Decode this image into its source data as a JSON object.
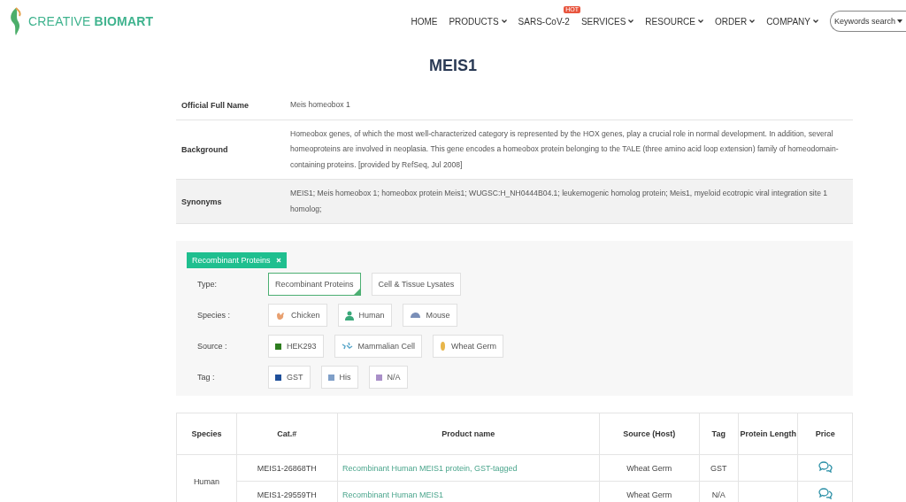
{
  "header": {
    "logo": {
      "word_1": "CREATIVE",
      "word_2": "BIOMART"
    },
    "nav": [
      {
        "label": "HOME",
        "dropdown": false
      },
      {
        "label": "PRODUCTS",
        "dropdown": true
      },
      {
        "label": "SARS-CoV-2",
        "dropdown": false,
        "badge": "HOT"
      },
      {
        "label": "SERVICES",
        "dropdown": true
      },
      {
        "label": "RESOURCE",
        "dropdown": true
      },
      {
        "label": "ORDER",
        "dropdown": true
      },
      {
        "label": "COMPANY",
        "dropdown": true
      }
    ],
    "search": {
      "placeholder": "Keywords search"
    }
  },
  "title": "MEIS1",
  "info": [
    {
      "label": "Official Full Name",
      "value": "Meis homeobox 1",
      "shaded": false
    },
    {
      "label": "Background",
      "value": "Homeobox genes, of which the most well-characterized category is represented by the HOX genes, play a crucial role in normal development. In addition, several homeoproteins are involved in neoplasia. This gene encodes a homeobox protein belonging to the TALE (three amino acid loop extension) family of homeodomain-containing proteins. [provided by RefSeq, Jul 2008]",
      "shaded": false
    },
    {
      "label": "Synonyms",
      "value": "MEIS1; Meis homeobox 1; homeobox protein Meis1; WUGSC:H_NH0444B04.1; leukemogenic homolog protein; Meis1, myeloid ecotropic viral integration site 1 homolog;",
      "shaded": true
    }
  ],
  "filters": {
    "active_tag": "Recombinant Proteins",
    "groups": [
      {
        "label": "Type:",
        "options": [
          {
            "label": "Recombinant Proteins",
            "kind": "plain",
            "selected": true
          },
          {
            "label": "Cell & Tissue Lysates",
            "kind": "plain",
            "selected": false
          }
        ]
      },
      {
        "label": "Species :",
        "options": [
          {
            "label": "Chicken",
            "kind": "chicken",
            "selected": false
          },
          {
            "label": "Human",
            "kind": "person",
            "selected": false
          },
          {
            "label": "Mouse",
            "kind": "mouse",
            "selected": false
          }
        ]
      },
      {
        "label": "Source :",
        "options": [
          {
            "label": "HEK293",
            "kind": "square",
            "color": "#2e7d1f",
            "selected": false
          },
          {
            "label": "Mammalian Cell",
            "kind": "cell",
            "selected": false
          },
          {
            "label": "Wheat Germ",
            "kind": "wheat",
            "selected": false
          }
        ]
      },
      {
        "label": "Tag :",
        "options": [
          {
            "label": "GST",
            "kind": "square",
            "color": "#1f4f9a",
            "selected": false
          },
          {
            "label": "His",
            "kind": "square",
            "color": "#7f9fc8",
            "selected": false
          },
          {
            "label": "N/A",
            "kind": "square",
            "color": "#a98fc8",
            "selected": false
          }
        ]
      }
    ]
  },
  "products": {
    "columns": [
      "Species",
      "Cat.#",
      "Product name",
      "Source (Host)",
      "Tag",
      "Protein Length",
      "Price"
    ],
    "groups": [
      {
        "species": "Human",
        "rows": [
          {
            "cat": "MEIS1-26868TH",
            "name": "Recombinant Human MEIS1 protein, GST-tagged",
            "source": "Wheat Germ",
            "tag": "GST"
          },
          {
            "cat": "MEIS1-29559TH",
            "name": "Recombinant Human MEIS1",
            "source": "Wheat Germ",
            "tag": "N/A"
          }
        ]
      }
    ]
  }
}
